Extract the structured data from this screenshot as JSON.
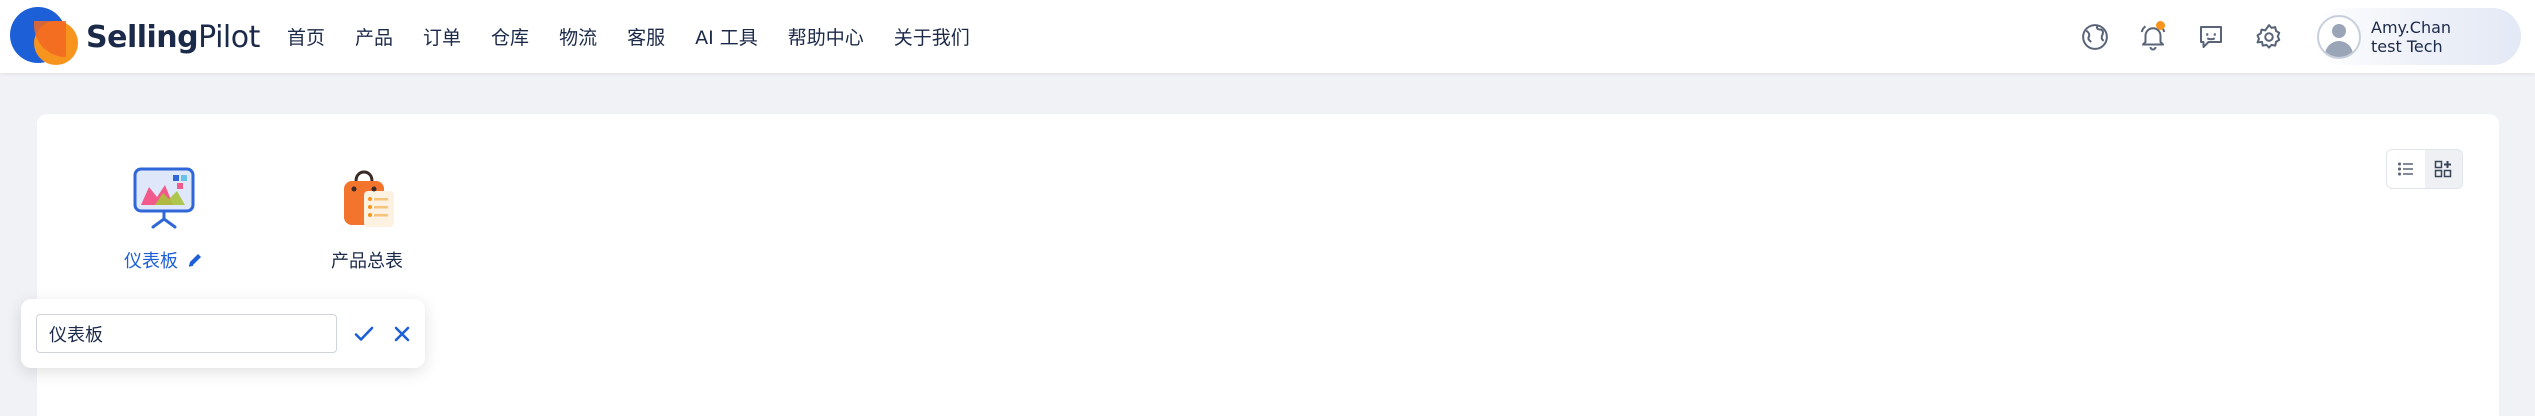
{
  "brand": {
    "name_bold": "Selling",
    "name_light": "Pilot"
  },
  "nav": {
    "items": [
      {
        "label": "首页"
      },
      {
        "label": "产品"
      },
      {
        "label": "订单"
      },
      {
        "label": "仓库"
      },
      {
        "label": "物流"
      },
      {
        "label": "客服"
      },
      {
        "label": "AI 工具"
      },
      {
        "label": "帮助中心"
      },
      {
        "label": "关于我们"
      }
    ]
  },
  "toolbar": {
    "icons": [
      "globe-icon",
      "bell-icon",
      "feedback-icon",
      "gear-icon"
    ],
    "has_notification": true
  },
  "user": {
    "name": "Amy.Chan",
    "company": "test Tech"
  },
  "apps": [
    {
      "label": "仪表板",
      "icon": "dashboard-chart-icon",
      "editing": true
    },
    {
      "label": "产品总表",
      "icon": "shopping-bag-icon",
      "editing": false
    }
  ],
  "view_toggle": {
    "options": [
      "list-view-icon",
      "grid-view-icon"
    ],
    "active": "grid-view-icon"
  },
  "rename_popover": {
    "value": "仪表板",
    "confirm_icon": "check-icon",
    "cancel_icon": "close-icon"
  },
  "colors": {
    "brand_blue": "#1d5fd6",
    "brand_orange": "#f7941d",
    "text_dark": "#1c2a4a",
    "page_bg": "#f1f2f6"
  }
}
